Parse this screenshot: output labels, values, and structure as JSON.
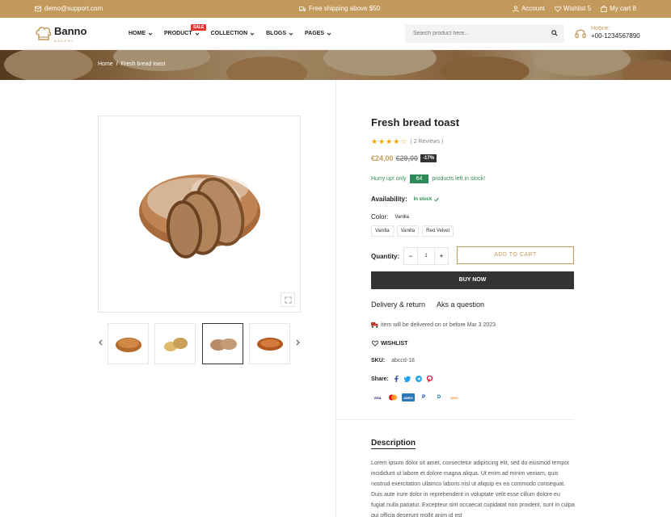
{
  "topbar": {
    "email": "demo@support.com",
    "shipping": "Free shipping above $50",
    "account": "Account",
    "wishlist": "Wishlist 5",
    "cart": "My cart 8"
  },
  "header": {
    "logo": "Banno",
    "logo_sub": "BAKERY",
    "nav": [
      {
        "label": "HOME"
      },
      {
        "label": "PRODUCT",
        "badge": "SALE"
      },
      {
        "label": "COLLECTION"
      },
      {
        "label": "BLOGS"
      },
      {
        "label": "PAGES"
      }
    ],
    "search_placeholder": "Search product here...",
    "hotline_label": "Hotline:",
    "hotline_number": "+00-1234567890"
  },
  "breadcrumb": {
    "home": "Home",
    "sep": "/",
    "current": "Fresh bread toast"
  },
  "product": {
    "title": "Fresh bread toast",
    "rating": 4,
    "reviews": "( 2 Reviews )",
    "price_new": "€24,00",
    "price_old": "€29,00",
    "discount": "-17%",
    "stock_prefix": "Hurry up! only",
    "stock_count": "64",
    "stock_suffix": "products left in stock!",
    "availability_label": "Availability:",
    "availability_value": "In stock",
    "color_label": "Color:",
    "color_value": "Vanilla",
    "variants": [
      "Vanilla",
      "Vanilla",
      "Red Velvet"
    ],
    "quantity_label": "Quantity:",
    "quantity": "1",
    "add_to_cart": "ADD TO CART",
    "buy_now": "BUY NOW",
    "tab_delivery": "Delivery & return",
    "tab_question": "Aks a question",
    "delivery_text": "item will be delivered on or before Mar 3 2023",
    "wishlist": "WISHLIST",
    "sku_label": "SKU:",
    "sku_value": "abccd-18",
    "share_label": "Share:",
    "payments": [
      "VISA",
      "MC",
      "AMEX",
      "P",
      "D",
      "DISC"
    ]
  },
  "description": {
    "title": "Description",
    "body": "Lorem ipsum dolor sit amet, consectetur adipiscing elit, sed do eiusmod tempor incididunt ut labore et dolore magna aliqua. Ut enim ad minim veniam, quis nostrud exercitation ullamco laboris nisi ut aliquip ex ea commodo consequat. Duis aute irure dolor in reprehenderit in voluptate velit esse cillum dolore eu fugiat nulla pariatur. Excepteur sint occaecat cupidatat non proident, sunt in culpa qui officia deserunt mollit anim id est"
  },
  "colors": {
    "accent": "#c49a5c",
    "dark": "#333333",
    "success": "#2e8b57",
    "sale": "#e53935"
  }
}
